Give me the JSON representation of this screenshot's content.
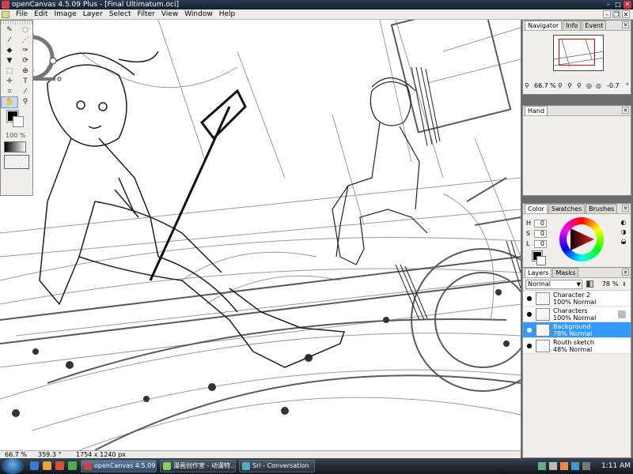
{
  "window": {
    "title": "openCanvas 4.5.09 Plus - [Final Ultimatum.oci]"
  },
  "menu": [
    "File",
    "Edit",
    "Image",
    "Layer",
    "Select",
    "Filter",
    "View",
    "Window",
    "Help"
  ],
  "tool_palette": {
    "tools": [
      "pencil-icon",
      "lasso-icon",
      "brush-icon",
      "airbrush-icon",
      "water-icon",
      "marker-icon",
      "bucket-icon",
      "rotate-icon",
      "rect-select-icon",
      "zoom-icon",
      "move-icon",
      "text-icon",
      "crop-icon",
      "eyedropper-icon",
      "hand-icon",
      "magnify-icon"
    ],
    "opacity_label": "100",
    "opacity_unit": "%"
  },
  "navigator": {
    "tabs": [
      "Navigator",
      "Info",
      "Event"
    ],
    "zoom": "66.7",
    "zoom_unit": "%",
    "rotation": "-0.7",
    "rotation_unit": "°"
  },
  "hand_panel": {
    "tab": "Hand"
  },
  "color_panel": {
    "tabs": [
      "Color",
      "Swatches",
      "Brushes"
    ],
    "h_label": "H",
    "h_value": "0",
    "s_label": "S",
    "s_value": "0",
    "l_label": "L",
    "l_value": "0"
  },
  "layers_panel": {
    "tabs": [
      "Layers",
      "Masks"
    ],
    "blend_mode": "Normal",
    "opacity": "78",
    "opacity_unit": "%",
    "layers": [
      {
        "name": "Character 2",
        "mode": "100% Normal",
        "selected": false
      },
      {
        "name": "Characters",
        "mode": "100% Normal",
        "selected": false
      },
      {
        "name": "Background",
        "mode": "78% Normal",
        "selected": true
      },
      {
        "name": "Routh sketch",
        "mode": "48% Normal",
        "selected": false
      }
    ]
  },
  "status_bar": {
    "zoom": "66.7 %",
    "rotation": "359.3 °",
    "size": "1754 x 1240 px"
  },
  "taskbar": {
    "tasks": [
      {
        "label": "openCanvas 4.5.09 ...",
        "active": true
      },
      {
        "label": "漫画创作室 - 动漫特...",
        "active": false
      },
      {
        "label": "Sri - Conversation",
        "active": false
      }
    ],
    "clock": "1:11 AM"
  },
  "colors": {
    "selection": "#3399ff",
    "taskbar": "#1c2430",
    "panel_bg": "#f0efec"
  }
}
